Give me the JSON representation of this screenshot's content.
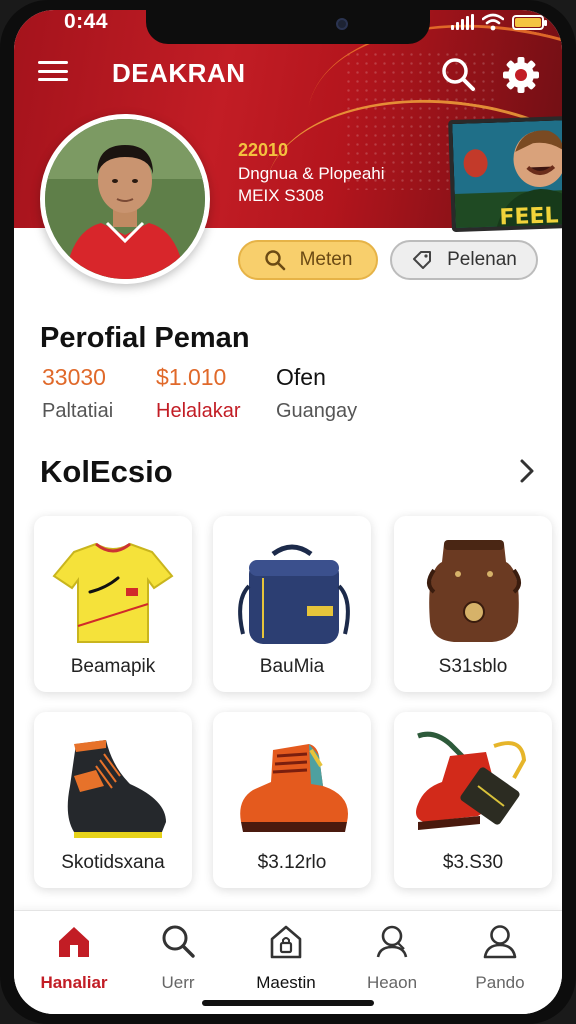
{
  "status": {
    "time": "0:44"
  },
  "header": {
    "title": "DEAKRAN"
  },
  "promo": {
    "accent": "22010",
    "line1": "Dngnua & Plopeahi",
    "line2": "MEIX S308"
  },
  "actions": {
    "primary_label": "Meten",
    "secondary_label": "Pelenan"
  },
  "profile": {
    "title": "Perofial Peman",
    "stats": [
      {
        "value": "33030",
        "label": "Paltatiai",
        "value_color": "#e0692a",
        "label_color": "#555555"
      },
      {
        "value": "$1.010",
        "label": "Helalakar",
        "value_color": "#e0692a",
        "label_color": "#c21d25"
      },
      {
        "value": "Ofen",
        "label": "Guangay",
        "value_color": "#111111",
        "label_color": "#555555"
      }
    ]
  },
  "collection": {
    "title": "KolEcsio",
    "items": [
      {
        "label": "Beamapik",
        "icon": "jersey-icon"
      },
      {
        "label": "BauMia",
        "icon": "bag-icon"
      },
      {
        "label": "S31sblo",
        "icon": "leather-boot-icon"
      },
      {
        "label": "Skotidsxana",
        "icon": "cleat-icon"
      },
      {
        "label": "$3.12rlo",
        "icon": "orange-boot-icon"
      },
      {
        "label": "$3.S30",
        "icon": "red-boot-icon"
      }
    ]
  },
  "nav": {
    "tabs": [
      {
        "label": "Hanaliar",
        "icon": "home-icon"
      },
      {
        "label": "Uerr",
        "icon": "search-icon"
      },
      {
        "label": "Maestin",
        "icon": "locker-icon"
      },
      {
        "label": "Heaon",
        "icon": "chat-user-icon"
      },
      {
        "label": "Pando",
        "icon": "profile-icon"
      }
    ]
  },
  "colors": {
    "brand": "#c21d25",
    "accent": "#e0692a",
    "pill": "#f8cf6c"
  }
}
